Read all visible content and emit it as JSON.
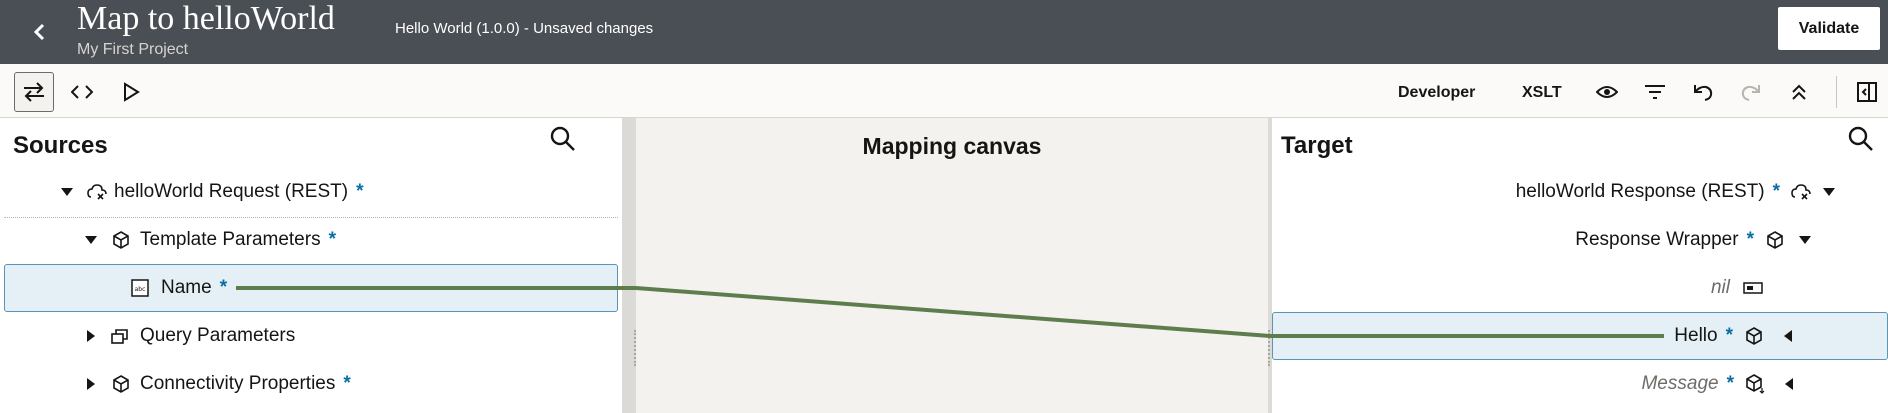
{
  "header": {
    "title": "Map to helloWorld",
    "subtitle": "My First Project",
    "status": "Hello World (1.0.0) - Unsaved changes",
    "validate_label": "Validate"
  },
  "toolbar": {
    "developer_label": "Developer",
    "xslt_label": "XSLT"
  },
  "sources": {
    "title": "Sources",
    "root": "helloWorld Request (REST)",
    "template_params": "Template Parameters",
    "name": "Name",
    "query_params": "Query Parameters",
    "connectivity": "Connectivity Properties",
    "required_mark": "*"
  },
  "canvas": {
    "title": "Mapping canvas"
  },
  "target": {
    "title": "Target",
    "root": "helloWorld Response (REST)",
    "wrapper": "Response Wrapper",
    "nil": "nil",
    "hello": "Hello",
    "message": "Message",
    "required_mark": "*"
  },
  "colors": {
    "header_bg": "#4a4f55",
    "selected_row_bg": "#e4f0f6",
    "mapping_line": "#5d7e4c",
    "required_star": "#0a6ea3"
  }
}
